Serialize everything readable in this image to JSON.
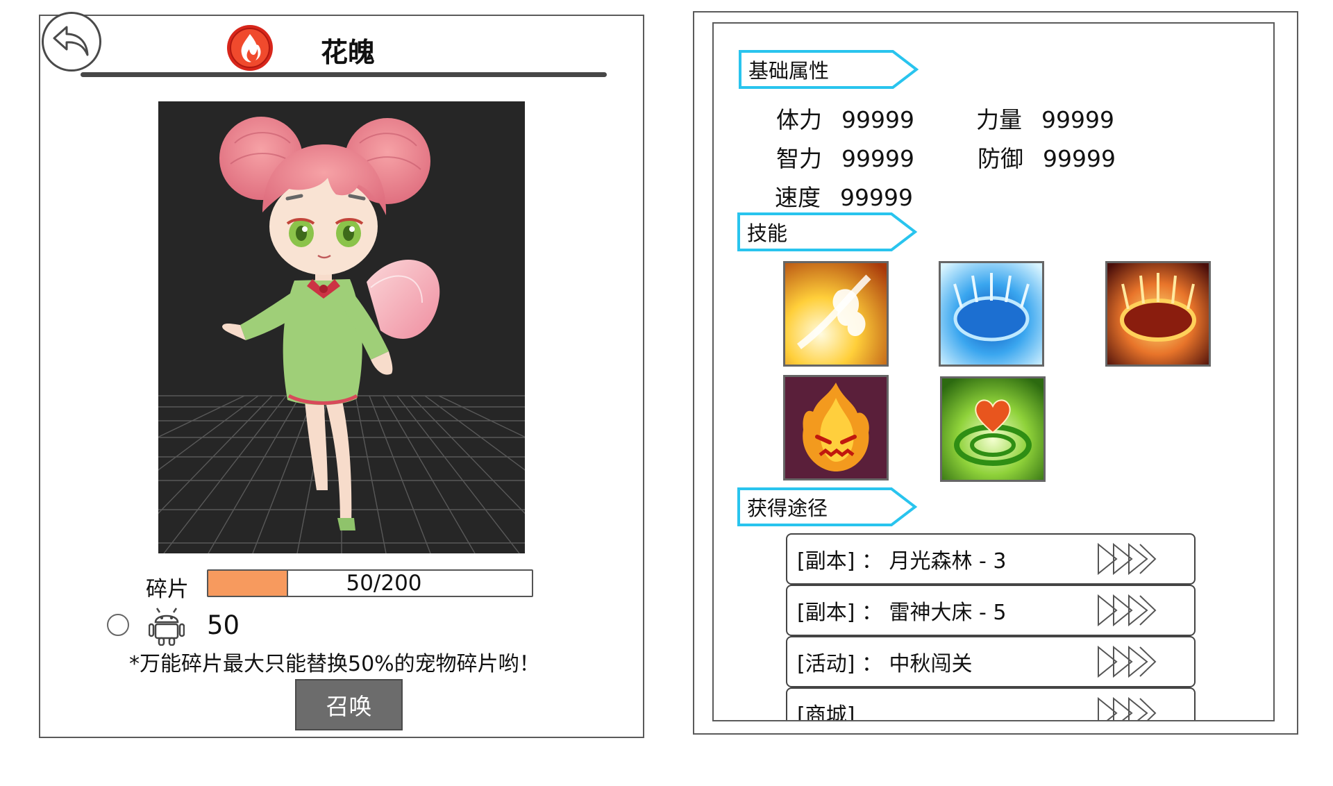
{
  "pet": {
    "name": "花魄",
    "fragment_label": "碎片",
    "fragment_progress_text": "50/200",
    "fragment_current": 50,
    "fragment_total": 200,
    "universal_fragment_count": "50",
    "swap_note": "*万能碎片最大只能替换50%的宠物碎片哟！",
    "summon_label": "召唤"
  },
  "colors": {
    "progress_fill": "#f79a5e",
    "section_border": "#29c4ee",
    "summon_button": "#6c6c6c"
  },
  "sections": {
    "base_stats": "基础属性",
    "skills": "技能",
    "sources": "获得途径"
  },
  "stats": [
    {
      "label": "体力",
      "value": "99999"
    },
    {
      "label": "力量",
      "value": "99999"
    },
    {
      "label": "智力",
      "value": "99999"
    },
    {
      "label": "防御",
      "value": "99999"
    },
    {
      "label": "速度",
      "value": "99999"
    }
  ],
  "skills": [
    {
      "icon": "wind-slash-skill-icon"
    },
    {
      "icon": "water-crater-skill-icon"
    },
    {
      "icon": "fire-crater-skill-icon"
    },
    {
      "icon": "angry-flame-skill-icon"
    },
    {
      "icon": "heart-heal-skill-icon"
    }
  ],
  "sources": [
    {
      "text": "[副本] ： 月光森林 - 3"
    },
    {
      "text": "[副本] ： 雷神大床 - 5"
    },
    {
      "text": "[活动] ： 中秋闯关"
    },
    {
      "text": "[商城]"
    }
  ]
}
